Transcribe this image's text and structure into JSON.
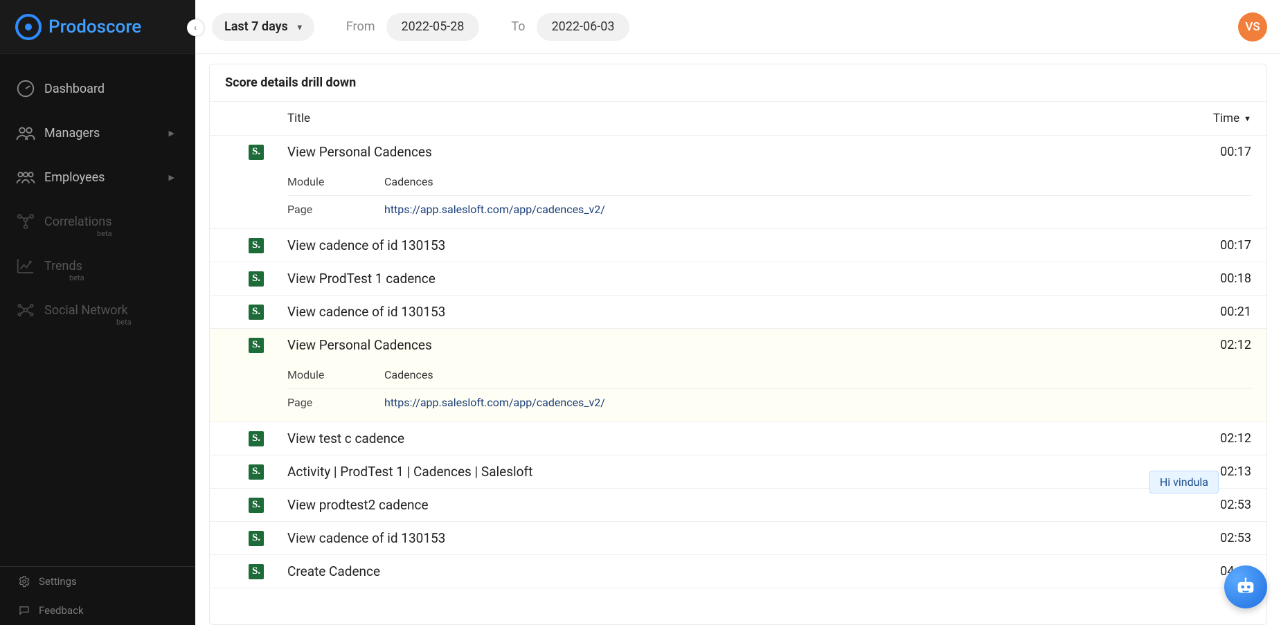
{
  "brand": {
    "name": "Prodoscore"
  },
  "sidebar": {
    "items": [
      {
        "label": "Dashboard",
        "name": "sidebar-item-dashboard",
        "icon": "gauge",
        "dim": false,
        "caret": false
      },
      {
        "label": "Managers",
        "name": "sidebar-item-managers",
        "icon": "group",
        "dim": false,
        "caret": true
      },
      {
        "label": "Employees",
        "name": "sidebar-item-employees",
        "icon": "group3",
        "dim": false,
        "caret": true
      },
      {
        "label": "Correlations",
        "name": "sidebar-item-correlations",
        "icon": "network",
        "dim": true,
        "caret": false,
        "beta": true,
        "betaClass": ""
      },
      {
        "label": "Trends",
        "name": "sidebar-item-trends",
        "icon": "trend",
        "dim": true,
        "caret": false,
        "beta": true,
        "betaClass": "tr"
      },
      {
        "label": "Social Network",
        "name": "sidebar-item-social-network",
        "icon": "social",
        "dim": true,
        "caret": false,
        "beta": true,
        "betaClass": "sn"
      }
    ],
    "beta_label": "beta",
    "bottom": {
      "settings": "Settings",
      "feedback": "Feedback"
    }
  },
  "topbar": {
    "range_label": "Last 7 days",
    "from_label": "From",
    "to_label": "To",
    "date_from": "2022-05-28",
    "date_to": "2022-06-03",
    "avatar_initials": "VS"
  },
  "panel": {
    "title": "Score details drill down",
    "columns": {
      "title": "Title",
      "time": "Time"
    }
  },
  "rows": [
    {
      "title": "View Personal Cadences",
      "time": "00:17",
      "highlight": false,
      "details": [
        {
          "key": "Module",
          "value": "Cadences",
          "link": false
        },
        {
          "key": "Page",
          "value": "https://app.salesloft.com/app/cadences_v2/",
          "link": true
        }
      ]
    },
    {
      "title": "View cadence of id 130153",
      "time": "00:17",
      "highlight": false
    },
    {
      "title": "View ProdTest 1 cadence",
      "time": "00:18",
      "highlight": false
    },
    {
      "title": "View cadence of id 130153",
      "time": "00:21",
      "highlight": false
    },
    {
      "title": "View Personal Cadences",
      "time": "02:12",
      "highlight": true,
      "details": [
        {
          "key": "Module",
          "value": "Cadences",
          "link": false
        },
        {
          "key": "Page",
          "value": "https://app.salesloft.com/app/cadences_v2/",
          "link": true
        }
      ]
    },
    {
      "title": "View test c cadence",
      "time": "02:12",
      "highlight": false
    },
    {
      "title": "Activity | ProdTest 1 | Cadences | Salesloft",
      "time": "02:13",
      "highlight": false
    },
    {
      "title": "View prodtest2 cadence",
      "time": "02:53",
      "highlight": false
    },
    {
      "title": "View cadence of id 130153",
      "time": "02:53",
      "highlight": false
    },
    {
      "title": "Create Cadence",
      "time": "04:46",
      "highlight": false
    }
  ],
  "chat": {
    "tooltip": "Hi vindula"
  }
}
